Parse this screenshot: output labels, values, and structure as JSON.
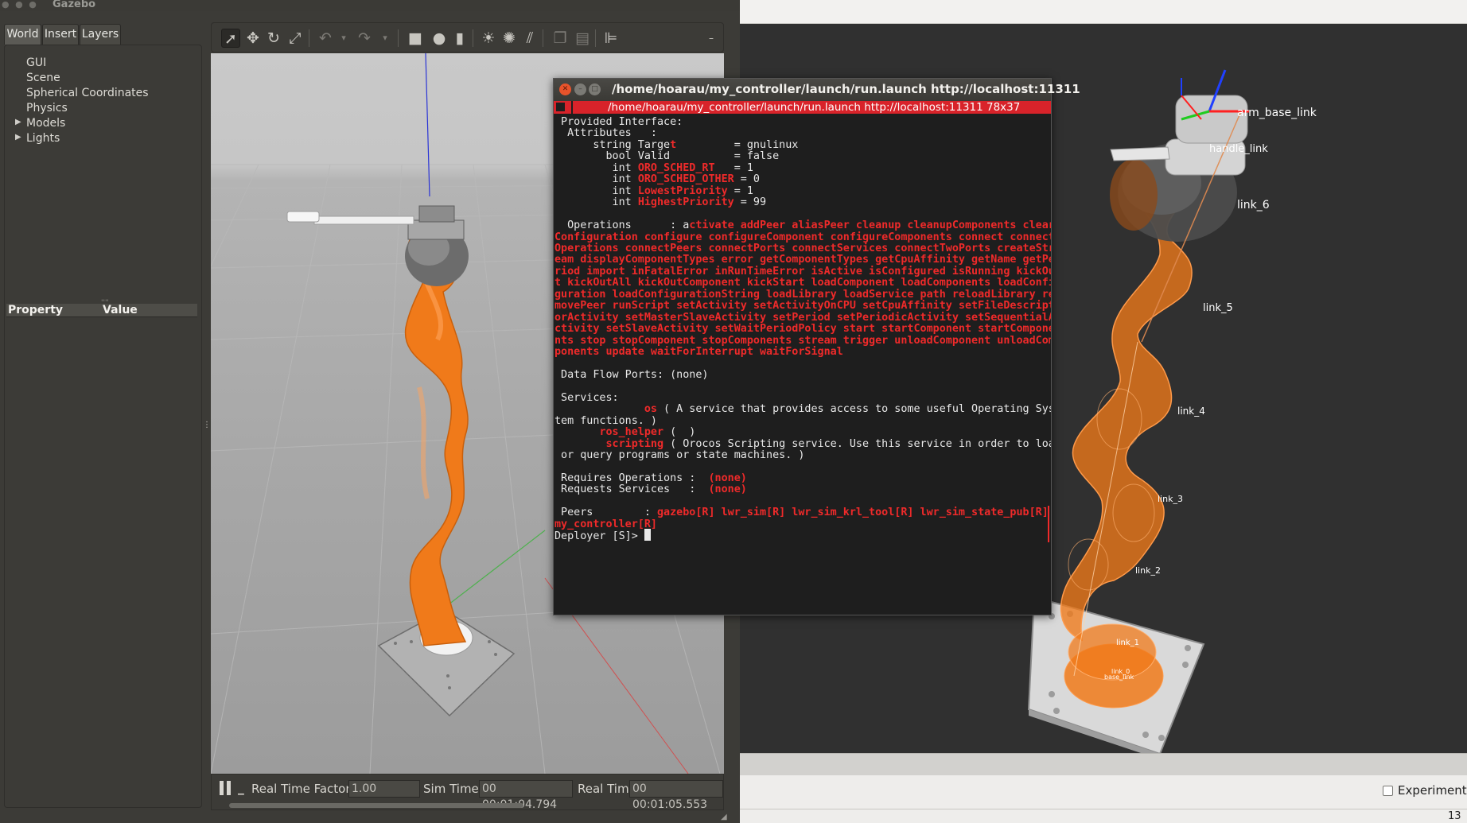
{
  "gazebo": {
    "window_title": "Gazebo",
    "tabs": [
      "World",
      "Insert",
      "Layers"
    ],
    "tree": [
      {
        "label": "GUI",
        "expandable": false
      },
      {
        "label": "Scene",
        "expandable": false
      },
      {
        "label": "Spherical Coordinates",
        "expandable": false
      },
      {
        "label": "Physics",
        "expandable": false
      },
      {
        "label": "Models",
        "expandable": true
      },
      {
        "label": "Lights",
        "expandable": true
      }
    ],
    "properties": {
      "col_property": "Property",
      "col_value": "Value"
    },
    "toolbar_icons": [
      "select-arrow-icon",
      "translate-icon",
      "rotate-icon",
      "scale-icon",
      "undo-icon",
      "undo-dropdown-icon",
      "redo-icon",
      "redo-dropdown-icon",
      "box-icon",
      "sphere-icon",
      "cylinder-icon",
      "point-light-icon",
      "spot-light-icon",
      "directional-light-icon",
      "copy-icon",
      "paste-icon",
      "align-icon",
      "more-icon"
    ],
    "status": {
      "real_time_factor_label": "Real Time Factor:",
      "real_time_factor": "1.00",
      "sim_time_label": "Sim Time:",
      "sim_time": "00 00:01:04.794",
      "real_time_label": "Real Time:",
      "real_time": "00 00:01:05.553"
    }
  },
  "terminal": {
    "title": "/home/hoarau/my_controller/launch/run.launch http://localhost:11311",
    "tab_title": "/home/hoarau/my_controller/launch/run.launch http://localhost:11311 78x37",
    "lines": [
      " Provided Interface:",
      "  Attributes   :",
      "      string Target         = gnulinux",
      "        bool Valid          = false",
      "         int ORO_SCHED_RT   = 1",
      "         int ORO_SCHED_OTHER = 0",
      "         int LowestPriority = 1",
      "         int HighestPriority = 99",
      "",
      "  Operations      : activate addPeer aliasPeer cleanup cleanupComponents clear",
      "Configuration configure configureComponent configureComponents connect connect",
      "Operations connectPeers connectPorts connectServices connectTwoPorts createStr",
      "eam displayComponentTypes error getComponentTypes getCpuAffinity getName getPe",
      "riod import inFatalError inRunTimeError isActive isConfigured isRunning kickOu",
      "t kickOutAll kickOutComponent kickStart loadComponent loadComponents loadConfi",
      "guration loadConfigurationString loadLibrary loadService path reloadLibrary re",
      "movePeer runScript setActivity setActivityOnCPU setCpuAffinity setFileDescript",
      "orActivity setMasterSlaveActivity setPeriod setPeriodicActivity setSequentialA",
      "ctivity setSlaveActivity setWaitPeriodPolicy start startComponent startCompone",
      "nts stop stopComponent stopComponents stream trigger unloadComponent unloadCom",
      "ponents update waitForInterrupt waitForSignal",
      "",
      " Data Flow Ports: (none)",
      "",
      " Services:",
      "              os ( A service that provides access to some useful Operating Sys",
      "tem functions. )",
      "       ros_helper (  )",
      "        scripting ( Orocos Scripting service. Use this service in order to load",
      " or query programs or state machines. )",
      "",
      " Requires Operations :  (none)",
      " Requests Services   :  (none)",
      "",
      " Peers        : gazebo[R] lwr_sim[R] lwr_sim_krl_tool[R] lwr_sim_state_pub[R]",
      "my_controller[R]",
      "Deployer [S]> "
    ],
    "red_ranges": {
      "2": [
        [
          18,
          24
        ]
      ],
      "3": [
        [
          20,
          25
        ]
      ],
      "4": [
        [
          13,
          25
        ]
      ],
      "5": [
        [
          13,
          28
        ]
      ],
      "6": [
        [
          13,
          27
        ]
      ],
      "7": [
        [
          13,
          28
        ]
      ],
      "9": [
        [
          21,
          80
        ]
      ],
      "10": [
        [
          0,
          80
        ]
      ],
      "11": [
        [
          0,
          80
        ]
      ],
      "12": [
        [
          0,
          80
        ]
      ],
      "13": [
        [
          0,
          80
        ]
      ],
      "14": [
        [
          0,
          80
        ]
      ],
      "15": [
        [
          0,
          80
        ]
      ],
      "16": [
        [
          0,
          80
        ]
      ],
      "17": [
        [
          0,
          80
        ]
      ],
      "18": [
        [
          0,
          80
        ]
      ],
      "19": [
        [
          0,
          80
        ]
      ],
      "20": [
        [
          0,
          80
        ]
      ],
      "25": [
        [
          14,
          16
        ]
      ],
      "27": [
        [
          7,
          17
        ]
      ],
      "28": [
        [
          8,
          17
        ]
      ],
      "31": [
        [
          24,
          30
        ]
      ],
      "32": [
        [
          24,
          30
        ]
      ],
      "34": [
        [
          16,
          80
        ]
      ],
      "35": [
        [
          0,
          16
        ]
      ]
    }
  },
  "rviz": {
    "link_labels": [
      "arm_base_link",
      "handle_link",
      "link_6",
      "link_5",
      "link_4",
      "link_3",
      "link_2",
      "link_1",
      "link_0",
      "base_link"
    ],
    "experimental_label": "Experimenta",
    "fps": "13"
  },
  "colors": {
    "robot_orange": "#f07a1a",
    "terminal_red": "#ef2a2a",
    "terminal_bg": "#1e1e1e",
    "ubuntu_dark": "#3c3b37"
  }
}
